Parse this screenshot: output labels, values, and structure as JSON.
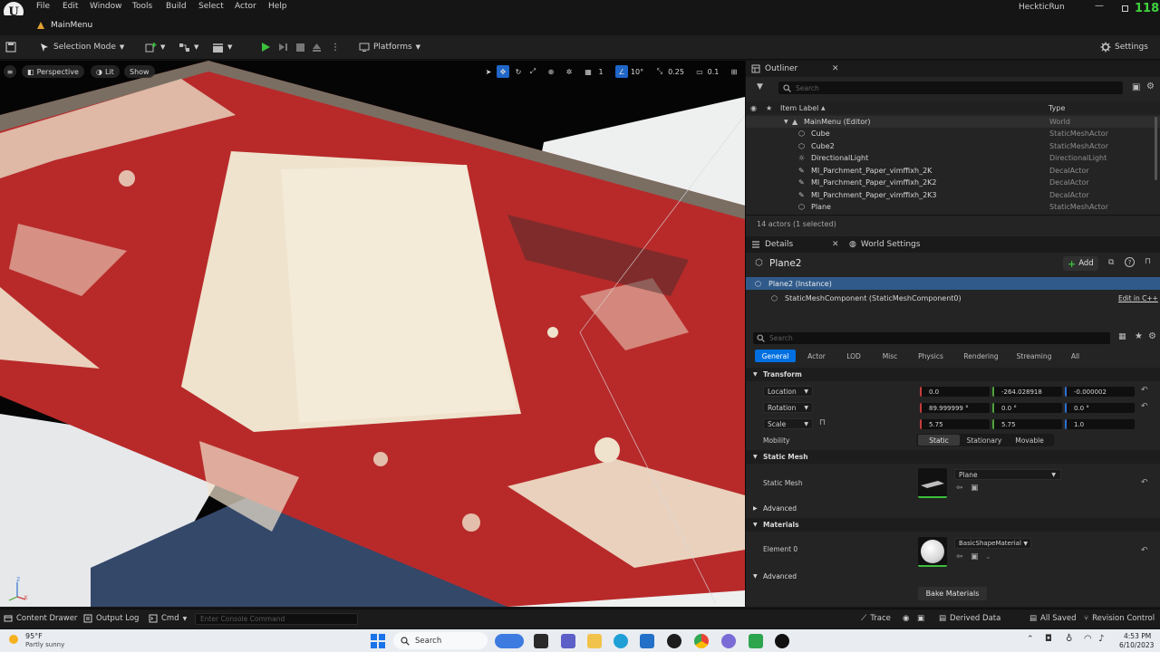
{
  "app": {
    "logo_text": "U",
    "project_name": "HeckticRun",
    "tab_label": "MainMenu",
    "fps": "118"
  },
  "menu": [
    "File",
    "Edit",
    "Window",
    "Tools",
    "Build",
    "Select",
    "Actor",
    "Help"
  ],
  "toolbar": {
    "selection_mode": "Selection Mode",
    "platforms": "Platforms",
    "settings": "Settings"
  },
  "viewport": {
    "perspective": "Perspective",
    "lit": "Lit",
    "show": "Show",
    "grid_size": "1",
    "rotation_snap": "10°",
    "scale_snap": "0.25",
    "camera_speed": "0.1",
    "axis_z": "z",
    "axis_x": "x"
  },
  "outliner": {
    "title": "Outliner",
    "search_placeholder": "Search",
    "col_label": "Item Label",
    "col_type": "Type",
    "rows": [
      {
        "label": "MainMenu (Editor)",
        "type": "World"
      },
      {
        "label": "Cube",
        "type": "StaticMeshActor"
      },
      {
        "label": "Cube2",
        "type": "StaticMeshActor"
      },
      {
        "label": "DirectionalLight",
        "type": "DirectionalLight"
      },
      {
        "label": "MI_Parchment_Paper_vimffixh_2K",
        "type": "DecalActor"
      },
      {
        "label": "MI_Parchment_Paper_vimffixh_2K2",
        "type": "DecalActor"
      },
      {
        "label": "MI_Parchment_Paper_vimffixh_2K3",
        "type": "DecalActor"
      },
      {
        "label": "Plane",
        "type": "StaticMeshActor"
      }
    ],
    "count": "14 actors (1 selected)"
  },
  "details": {
    "tab_details": "Details",
    "tab_world_settings": "World Settings",
    "object_name": "Plane2",
    "add_label": "Add",
    "instance_label": "Plane2 (Instance)",
    "component_label": "StaticMeshComponent (StaticMeshComponent0)",
    "edit_cpp": "Edit in C++",
    "search_placeholder": "Search",
    "categories": [
      "General",
      "Actor",
      "LOD",
      "Misc",
      "Physics",
      "Rendering",
      "Streaming",
      "All"
    ],
    "transform": {
      "section": "Transform",
      "location_label": "Location",
      "location": [
        "0.0",
        "-264.028918",
        "-0.000002"
      ],
      "rotation_label": "Rotation",
      "rotation": [
        "89.999999 °",
        "0.0 °",
        "0.0 °"
      ],
      "scale_label": "Scale",
      "scale": [
        "5.75",
        "5.75",
        "1.0"
      ],
      "mobility_label": "Mobility",
      "mobility_options": [
        "Static",
        "Stationary",
        "Movable"
      ]
    },
    "static_mesh": {
      "section": "Static Mesh",
      "label": "Static Mesh",
      "value": "Plane"
    },
    "advanced_label": "Advanced",
    "materials": {
      "section": "Materials",
      "element_label": "Element 0",
      "value": "BasicShapeMaterial"
    },
    "bake_button": "Bake Materials"
  },
  "statusbar": {
    "content_drawer": "Content Drawer",
    "output_log": "Output Log",
    "cmd": "Cmd",
    "console_placeholder": "Enter Console Command",
    "trace": "Trace",
    "derived_data": "Derived Data",
    "all_saved": "All Saved",
    "revision_control": "Revision Control"
  },
  "taskbar": {
    "temperature": "95°F",
    "weather": "Partly sunny",
    "search": "Search",
    "time": "4:53 PM",
    "date": "6/10/2023"
  },
  "colors": {
    "accent_blue": "#0070e0",
    "play_green": "#3cbf3c",
    "x_red": "#c93c3c",
    "y_green": "#4fa33a",
    "z_blue": "#2f6fd0",
    "selected_row": "#2f5a8a"
  }
}
